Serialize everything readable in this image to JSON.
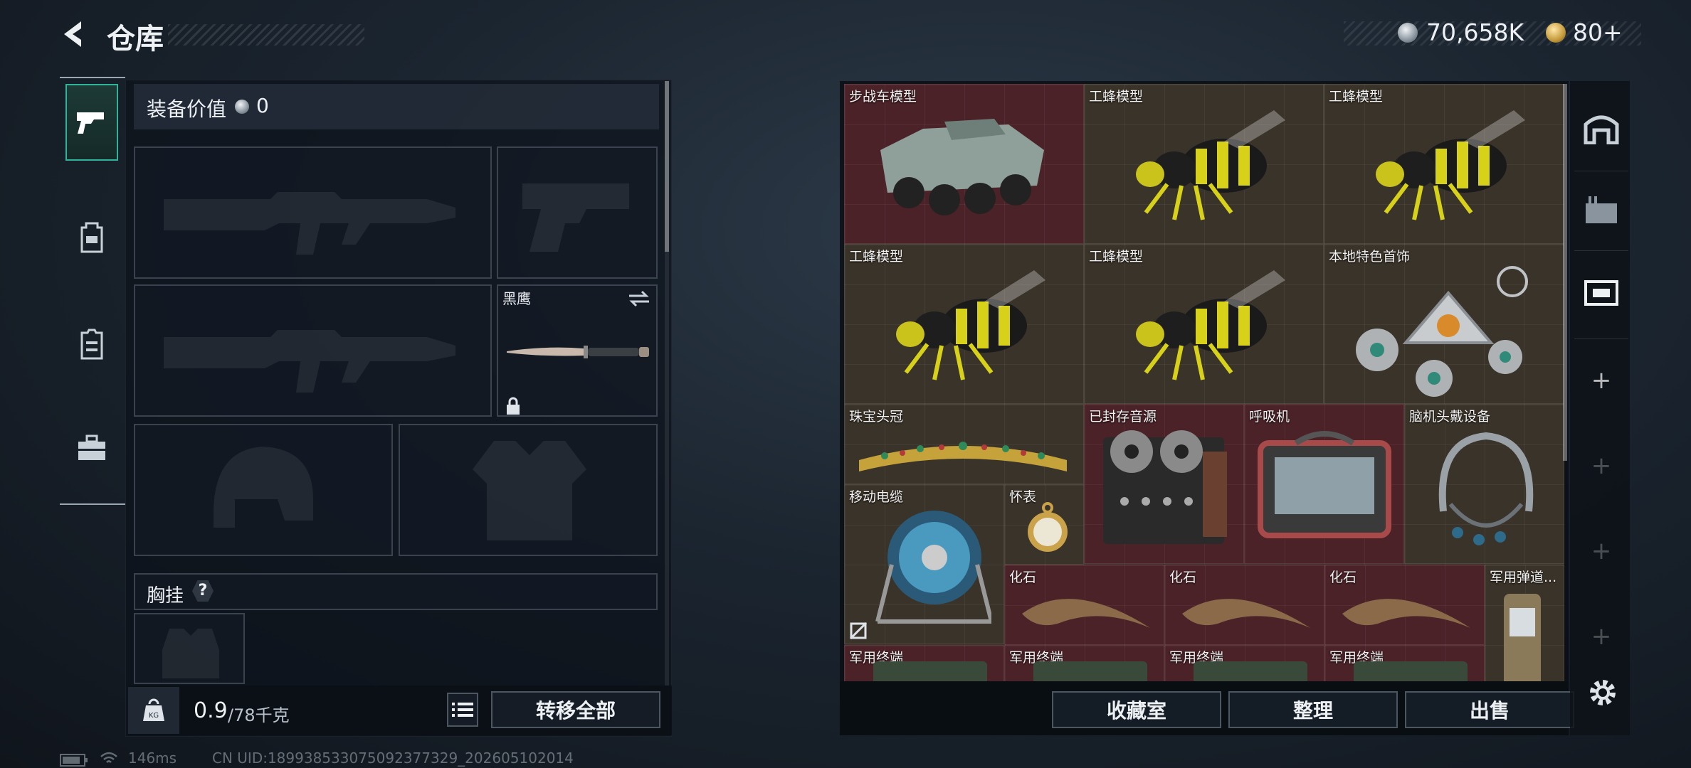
{
  "header": {
    "title": "仓库",
    "silver_amount": "70,658K",
    "gold_amount": "80+"
  },
  "left_tabs": [
    {
      "name": "weapon-tab",
      "active": true
    },
    {
      "name": "backpack-tab",
      "active": false
    },
    {
      "name": "vest-tab",
      "active": false
    },
    {
      "name": "case-tab",
      "active": false
    }
  ],
  "loadout": {
    "value_label": "装备价值",
    "value": "0",
    "melee_name": "黑鹰",
    "chest_label": "胸挂",
    "chest_help": "?",
    "weight_current": "0.9",
    "weight_max": "/78千克",
    "transfer_all": "转移全部"
  },
  "storage": {
    "items": [
      {
        "name": "步战车模型",
        "color": "red",
        "icon": "ifv-model-icon"
      },
      {
        "name": "工蜂模型",
        "color": "brown",
        "icon": "bee-model-icon"
      },
      {
        "name": "工蜂模型",
        "color": "brown",
        "icon": "bee-model-icon"
      },
      {
        "name": "工蜂模型",
        "color": "brown",
        "icon": "bee-model-icon"
      },
      {
        "name": "工蜂模型",
        "color": "brown",
        "icon": "bee-model-icon"
      },
      {
        "name": "本地特色首饰",
        "color": "brown",
        "icon": "jewelry-icon"
      },
      {
        "name": "珠宝头冠",
        "color": "brown",
        "icon": "tiara-icon"
      },
      {
        "name": "已封存音源",
        "color": "red",
        "icon": "reel-recorder-icon"
      },
      {
        "name": "呼吸机",
        "color": "red",
        "icon": "ventilator-icon"
      },
      {
        "name": "脑机头戴设备",
        "color": "brown",
        "icon": "headset-icon"
      },
      {
        "name": "移动电缆",
        "color": "brown",
        "icon": "cable-reel-icon"
      },
      {
        "name": "怀表",
        "color": "brown",
        "icon": "pocket-watch-icon"
      },
      {
        "name": "化石",
        "color": "red",
        "icon": "fossil-claw-icon"
      },
      {
        "name": "化石",
        "color": "red",
        "icon": "fossil-claw-icon"
      },
      {
        "name": "化石",
        "color": "red",
        "icon": "fossil-claw-icon"
      },
      {
        "name": "军用弹道...",
        "color": "brown",
        "icon": "ballistic-computer-icon"
      },
      {
        "name": "军用终端",
        "color": "red",
        "icon": "military-terminal-icon"
      },
      {
        "name": "军用终端",
        "color": "red",
        "icon": "military-terminal-icon"
      },
      {
        "name": "军用终端",
        "color": "red",
        "icon": "military-terminal-icon"
      },
      {
        "name": "军用终端",
        "color": "red",
        "icon": "military-terminal-icon"
      }
    ],
    "buttons": {
      "collection": "收藏室",
      "organize": "整理",
      "sell": "出售"
    }
  },
  "status": {
    "ping": "146ms",
    "uid": "CN UID:18993853307509237732​9_202605102014"
  }
}
